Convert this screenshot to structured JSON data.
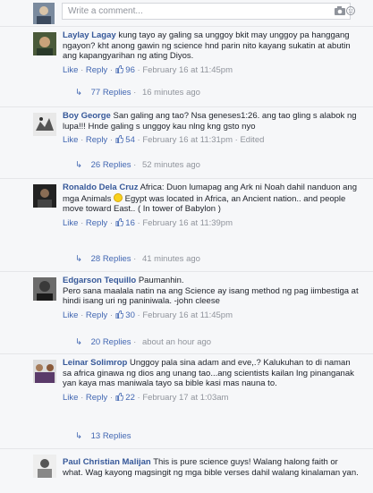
{
  "composer": {
    "placeholder": "Write a comment..."
  },
  "labels": {
    "like": "Like",
    "reply": "Reply",
    "dot": "·"
  },
  "comments": [
    {
      "author": "Laylay Lagay",
      "text": "kung tayo ay galing sa unggoy bkit may unggoy pa hanggang ngayon? kht anong gawin ng science hnd parin nito kayang sukatin at abutin ang kapangyarihan ng ating Diyos.",
      "likes": "96",
      "time": "February 16 at 11:45pm",
      "edited": "",
      "replies": "77 Replies",
      "replies_time": "16 minutes ago"
    },
    {
      "author": "Boy George",
      "text": "San galing ang tao? Nsa geneses1:26. ang tao gling s alabok ng lupa!!! Hnde galing s unggoy kau nlng kng gsto nyo",
      "likes": "54",
      "time": "February 16 at 11:31pm",
      "edited": "Edited",
      "replies": "26 Replies",
      "replies_time": "52 minutes ago"
    },
    {
      "author": "Ronaldo Dela Cruz",
      "text_a": "Africa: Duon lumapag ang Ark ni Noah dahil nanduon ang mga Animals",
      "text_b": "Egypt was located in Africa, an Ancient nation.. and people move toward East.. ( In tower of Babylon )",
      "likes": "16",
      "time": "February 16 at 11:39pm",
      "edited": "",
      "replies": "28 Replies",
      "replies_time": "41 minutes ago"
    },
    {
      "author": "Edgarson Tequillo",
      "text_a": "Paumanhin.",
      "text_b": "Pero sana maalala natin na ang Science ay isang method ng pag iimbestiga at hindi isang uri ng paniniwala. -john cleese",
      "likes": "30",
      "time": "February 16 at 11:45pm",
      "edited": "",
      "replies": "20 Replies",
      "replies_time": "about an hour ago"
    },
    {
      "author": "Leinar Solimrop",
      "text": "Unggoy pala sina adam and eve,.? Kalukuhan to di naman sa africa ginawa ng dios ang unang tao...ang scientists kailan Ing pinanganak yan kaya mas maniwala tayo sa bible kasi mas nauna to.",
      "likes": "22",
      "time": "February 17 at 1:03am",
      "edited": "",
      "replies": "13 Replies",
      "replies_time": ""
    },
    {
      "author": "Paul Christian Malijan",
      "text": "This is pure science guys! Walang halong faith or what. Wag kayong magsingit ng mga bible verses dahil walang kinalaman yan."
    }
  ],
  "colors": {
    "link": "#365899",
    "action": "#4267b2",
    "meta": "#90949c",
    "bg": "#f6f7f9"
  },
  "icons": [
    "camera-icon",
    "emoji-icon",
    "like-icon",
    "reply-arrow-icon",
    "smiley-emoji"
  ]
}
